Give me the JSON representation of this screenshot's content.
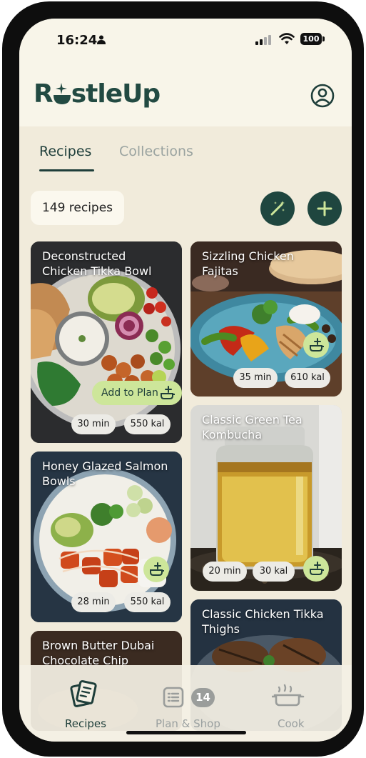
{
  "status": {
    "time": "16:24",
    "battery": "100"
  },
  "app": {
    "logo": "RustleUp",
    "logo_prefix": "R",
    "logo_suffix": "stleUp"
  },
  "tabs": [
    {
      "label": "Recipes",
      "active": true
    },
    {
      "label": "Collections",
      "active": false
    }
  ],
  "recipes_count": "149 recipes",
  "recipes": [
    {
      "title": "Deconstructed Chicken Tikka Bowl",
      "time": "30 min",
      "kcal": "550 kal",
      "action": "Add to Plan"
    },
    {
      "title": "Sizzling Chicken Fajitas",
      "time": "35 min",
      "kcal": "610 kal"
    },
    {
      "title": "Honey Glazed Salmon Bowls",
      "time": "28 min",
      "kcal": "550 kal"
    },
    {
      "title": "Classic Green Tea Kombucha",
      "time": "20 min",
      "kcal": "30 kal"
    },
    {
      "title": "Brown Butter Dubai Chocolate Chip",
      "time": "",
      "kcal": ""
    },
    {
      "title": "Classic Chicken Tikka Thighs",
      "time": "",
      "kcal": ""
    }
  ],
  "nav": [
    {
      "label": "Recipes",
      "icon": "recipes-icon",
      "active": true
    },
    {
      "label": "Plan & Shop",
      "icon": "list-icon",
      "badge": "14",
      "active": false
    },
    {
      "label": "Cook",
      "icon": "pot-icon",
      "active": false
    }
  ],
  "colors": {
    "brand": "#1f463f",
    "accent": "#cde69a",
    "background": "#f1ebdb"
  }
}
